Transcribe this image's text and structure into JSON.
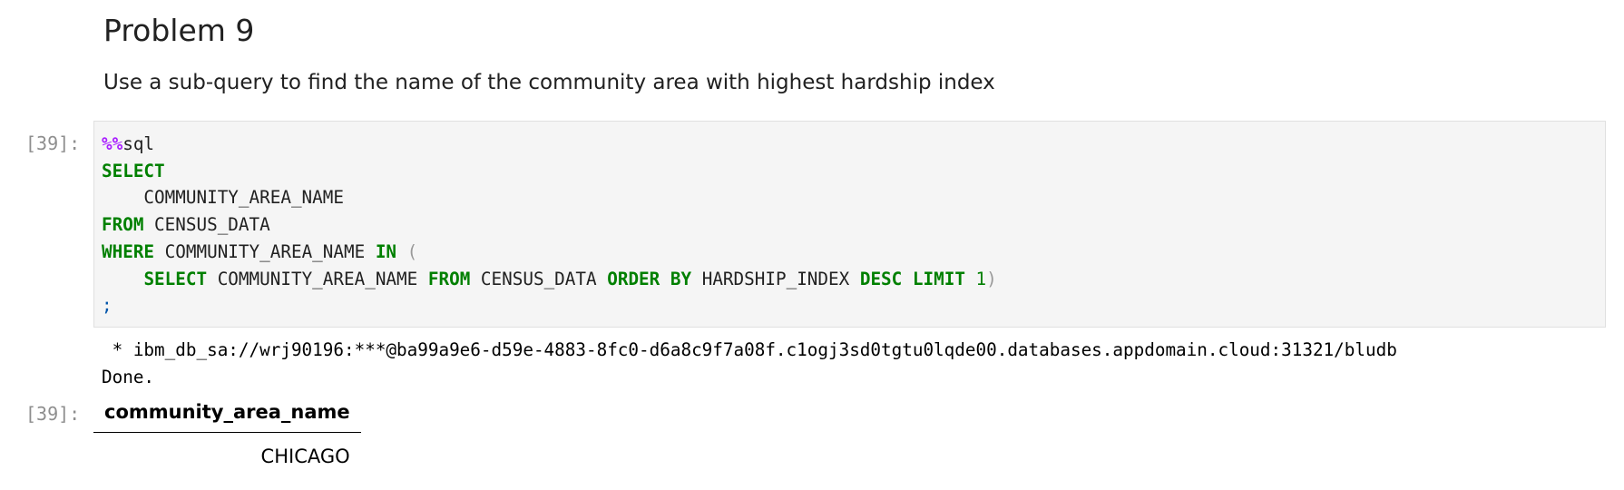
{
  "markdown": {
    "heading": "Problem 9",
    "text": "Use a sub-query to find the name of the community area with highest hardship index"
  },
  "input_cell": {
    "prompt": "[39]:",
    "code": {
      "magic": "%%",
      "magic_name": "sql",
      "kw_select": "SELECT",
      "col1": "    COMMUNITY_AREA_NAME",
      "kw_from": "FROM",
      "table1": " CENSUS_DATA",
      "kw_where": "WHERE",
      "where_col": " COMMUNITY_AREA_NAME ",
      "kw_in": "IN",
      "open_paren": " (",
      "indent": "    ",
      "sub_select": "SELECT",
      "sub_col": " COMMUNITY_AREA_NAME ",
      "sub_from": "FROM",
      "sub_table": " CENSUS_DATA ",
      "sub_order": "ORDER",
      "sub_by": "BY",
      "sub_order_col": " HARDSHIP_INDEX ",
      "sub_desc": "DESC",
      "sub_limit": "LIMIT",
      "sub_limit_val": "1",
      "close_paren": ")",
      "semicolon": ";"
    }
  },
  "stream_output": {
    "connection": " * ibm_db_sa://wrj90196:***@ba99a9e6-d59e-4883-8fc0-d6a8c9f7a08f.c1ogj3sd0tgtu0lqde00.databases.appdomain.cloud:31321/bludb",
    "status": "Done."
  },
  "output_cell": {
    "prompt": "[39]:",
    "table": {
      "header": "community_area_name",
      "rows": [
        "CHICAGO"
      ]
    }
  }
}
